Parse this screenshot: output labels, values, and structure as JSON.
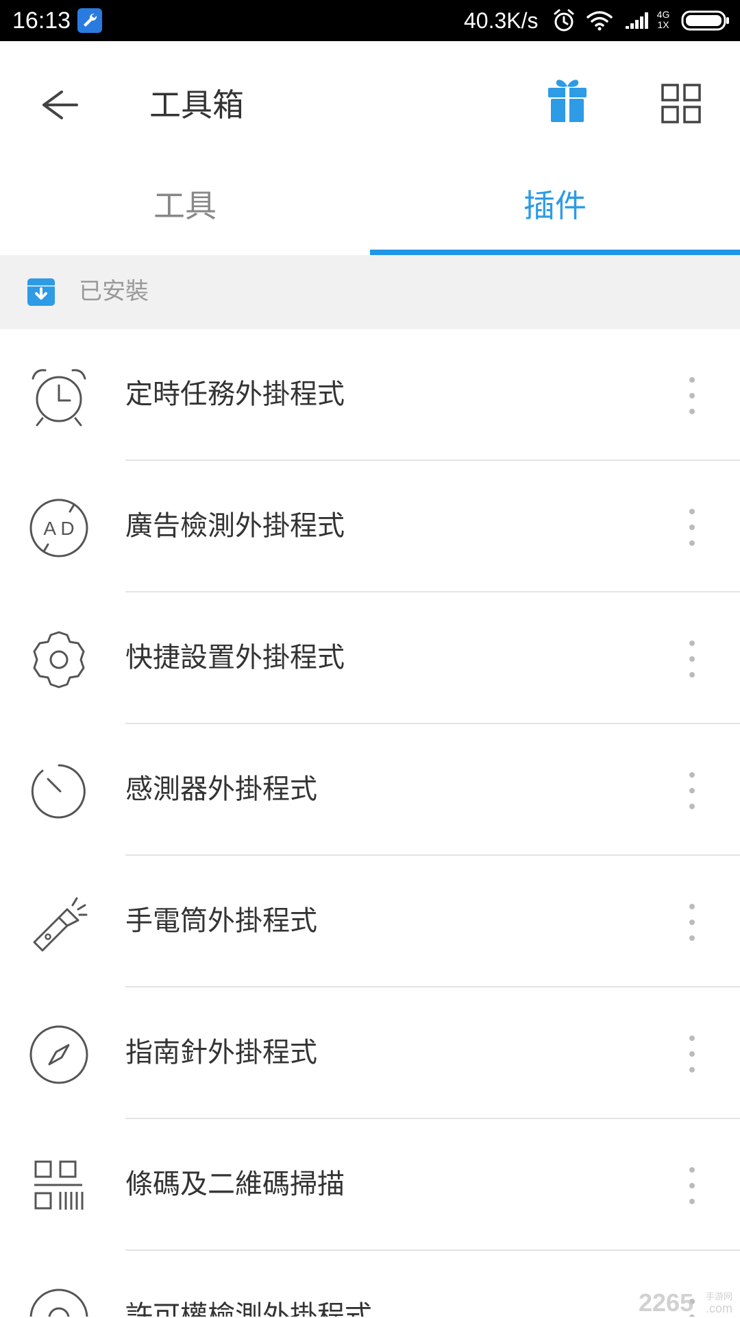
{
  "status_bar": {
    "time": "16:13",
    "speed": "40.3K/s",
    "network_top": "4G",
    "network_bottom": "1X"
  },
  "app_bar": {
    "title": "工具箱"
  },
  "tabs": [
    {
      "label": "工具",
      "selected": false
    },
    {
      "label": "插件",
      "selected": true
    }
  ],
  "section": {
    "label": "已安裝"
  },
  "plugins": [
    {
      "name": "定時任務外掛程式",
      "icon": "alarm-clock-icon"
    },
    {
      "name": "廣告檢測外掛程式",
      "icon": "ad-block-icon",
      "icon_text": "A D"
    },
    {
      "name": "快捷設置外掛程式",
      "icon": "gear-icon"
    },
    {
      "name": "感測器外掛程式",
      "icon": "sensor-dial-icon"
    },
    {
      "name": "手電筒外掛程式",
      "icon": "flashlight-icon"
    },
    {
      "name": "指南針外掛程式",
      "icon": "compass-icon"
    },
    {
      "name": "條碼及二維碼掃描",
      "icon": "qr-code-icon"
    },
    {
      "name": "許可權檢測外掛程式",
      "icon": "permission-icon"
    }
  ],
  "watermark": {
    "brand": "2265",
    "domain": ".com",
    "cn": "手游网"
  },
  "colors": {
    "accent": "#2196e8",
    "accent_text": "#2d9be5",
    "status_bar_bg": "#000000",
    "section_bg": "#f1f1f1",
    "divider": "#e3e3e3"
  }
}
